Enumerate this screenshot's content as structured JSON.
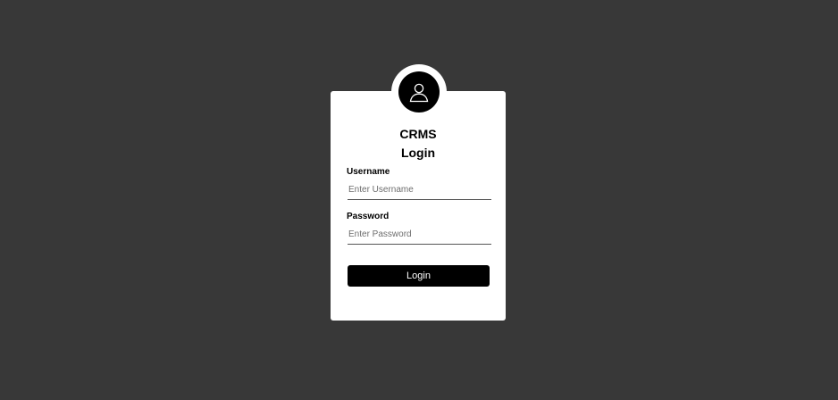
{
  "login_card": {
    "avatar_icon": "user-icon",
    "brand": "CRMS",
    "title": "Login",
    "username": {
      "label": "Username",
      "placeholder": "Enter Username",
      "value": ""
    },
    "password": {
      "label": "Password",
      "placeholder": "Enter Password",
      "value": ""
    },
    "submit_label": "Login"
  },
  "colors": {
    "background": "#383838",
    "card": "#ffffff",
    "accent": "#000000"
  }
}
